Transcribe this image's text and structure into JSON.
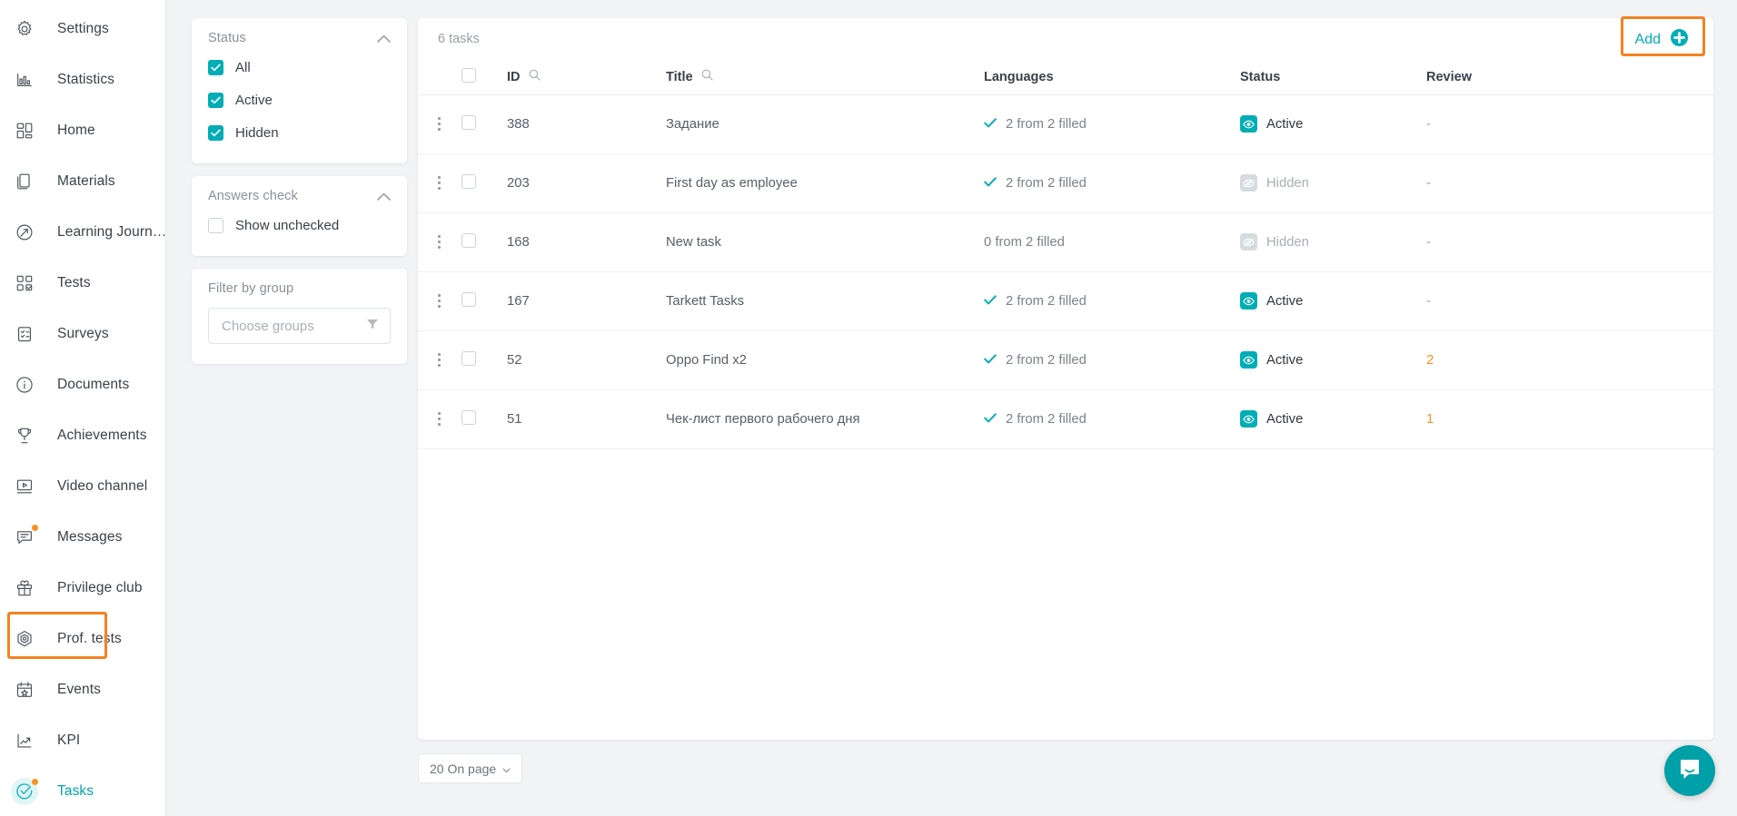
{
  "theme": {
    "accent": "#00adb5",
    "highlight": "#f58220",
    "orange_text": "#f7921e",
    "page_bg": "#f2f3f5"
  },
  "sidebar": {
    "items": [
      {
        "label": "Settings",
        "icon": "gear-icon",
        "active": false,
        "dot": false
      },
      {
        "label": "Statistics",
        "icon": "bar-chart-icon",
        "active": false,
        "dot": false
      },
      {
        "label": "Home",
        "icon": "dashboard-icon",
        "active": false,
        "dot": false
      },
      {
        "label": "Materials",
        "icon": "documents-icon",
        "active": false,
        "dot": false
      },
      {
        "label": "Learning Journ…",
        "icon": "journey-arrow-icon",
        "active": false,
        "dot": false
      },
      {
        "label": "Tests",
        "icon": "tests-grid-icon",
        "active": false,
        "dot": false
      },
      {
        "label": "Surveys",
        "icon": "clipboard-icon",
        "active": false,
        "dot": false
      },
      {
        "label": "Documents",
        "icon": "info-circle-icon",
        "active": false,
        "dot": false
      },
      {
        "label": "Achievements",
        "icon": "trophy-icon",
        "active": false,
        "dot": false
      },
      {
        "label": "Video channel",
        "icon": "video-icon",
        "active": false,
        "dot": false
      },
      {
        "label": "Messages",
        "icon": "chat-icon",
        "active": false,
        "dot": true
      },
      {
        "label": "Privilege club",
        "icon": "gift-icon",
        "active": false,
        "dot": false
      },
      {
        "label": "Prof. tests",
        "icon": "hexagon-icon",
        "active": false,
        "dot": false
      },
      {
        "label": "Events",
        "icon": "calendar-star-icon",
        "active": false,
        "dot": false
      },
      {
        "label": "KPI",
        "icon": "trend-line-icon",
        "active": false,
        "dot": false
      },
      {
        "label": "Tasks",
        "icon": "check-circle-icon",
        "active": true,
        "dot": true
      }
    ]
  },
  "filters": {
    "status": {
      "title": "Status",
      "collapse_icon": "chevron-up-icon",
      "options": [
        {
          "label": "All",
          "checked": true
        },
        {
          "label": "Active",
          "checked": true
        },
        {
          "label": "Hidden",
          "checked": true
        }
      ]
    },
    "answers_check": {
      "title": "Answers check",
      "collapse_icon": "chevron-up-icon",
      "options": [
        {
          "label": "Show unchecked",
          "checked": false
        }
      ]
    },
    "group": {
      "title": "Filter by group",
      "placeholder": "Choose groups",
      "icon": "funnel-icon"
    }
  },
  "main": {
    "task_count": "6 tasks",
    "add_label": "Add",
    "add_icon": "plus-circle-icon",
    "columns": [
      {
        "key": "menu",
        "label": "",
        "search": false
      },
      {
        "key": "select",
        "label": "",
        "search": false
      },
      {
        "key": "id",
        "label": "ID",
        "search": true
      },
      {
        "key": "title",
        "label": "Title",
        "search": true
      },
      {
        "key": "lang",
        "label": "Languages",
        "search": false
      },
      {
        "key": "status",
        "label": "Status",
        "search": false
      },
      {
        "key": "review",
        "label": "Review",
        "search": false
      }
    ],
    "rows": [
      {
        "id": "388",
        "title": "Задание",
        "languages": "2 from 2 filled",
        "lang_filled": true,
        "status": "Active",
        "status_state": "active",
        "review": "-"
      },
      {
        "id": "203",
        "title": "First day as employee",
        "languages": "2 from 2 filled",
        "lang_filled": true,
        "status": "Hidden",
        "status_state": "hidden",
        "review": "-"
      },
      {
        "id": "168",
        "title": "New task",
        "languages": "0 from 2 filled",
        "lang_filled": false,
        "status": "Hidden",
        "status_state": "hidden",
        "review": "-"
      },
      {
        "id": "167",
        "title": "Tarkett Tasks",
        "languages": "2 from 2 filled",
        "lang_filled": true,
        "status": "Active",
        "status_state": "active",
        "review": "-"
      },
      {
        "id": "52",
        "title": "Oppo Find x2",
        "languages": "2 from 2 filled",
        "lang_filled": true,
        "status": "Active",
        "status_state": "active",
        "review": "2"
      },
      {
        "id": "51",
        "title": "Чек-лист первого рабочего дня",
        "languages": "2 from 2 filled",
        "lang_filled": true,
        "status": "Active",
        "status_state": "active",
        "review": "1"
      }
    ],
    "pager": {
      "per_page_label": "20 On page",
      "chevron": "chevron-down-icon"
    }
  },
  "chat": {
    "icon": "intercom-chat-icon"
  }
}
